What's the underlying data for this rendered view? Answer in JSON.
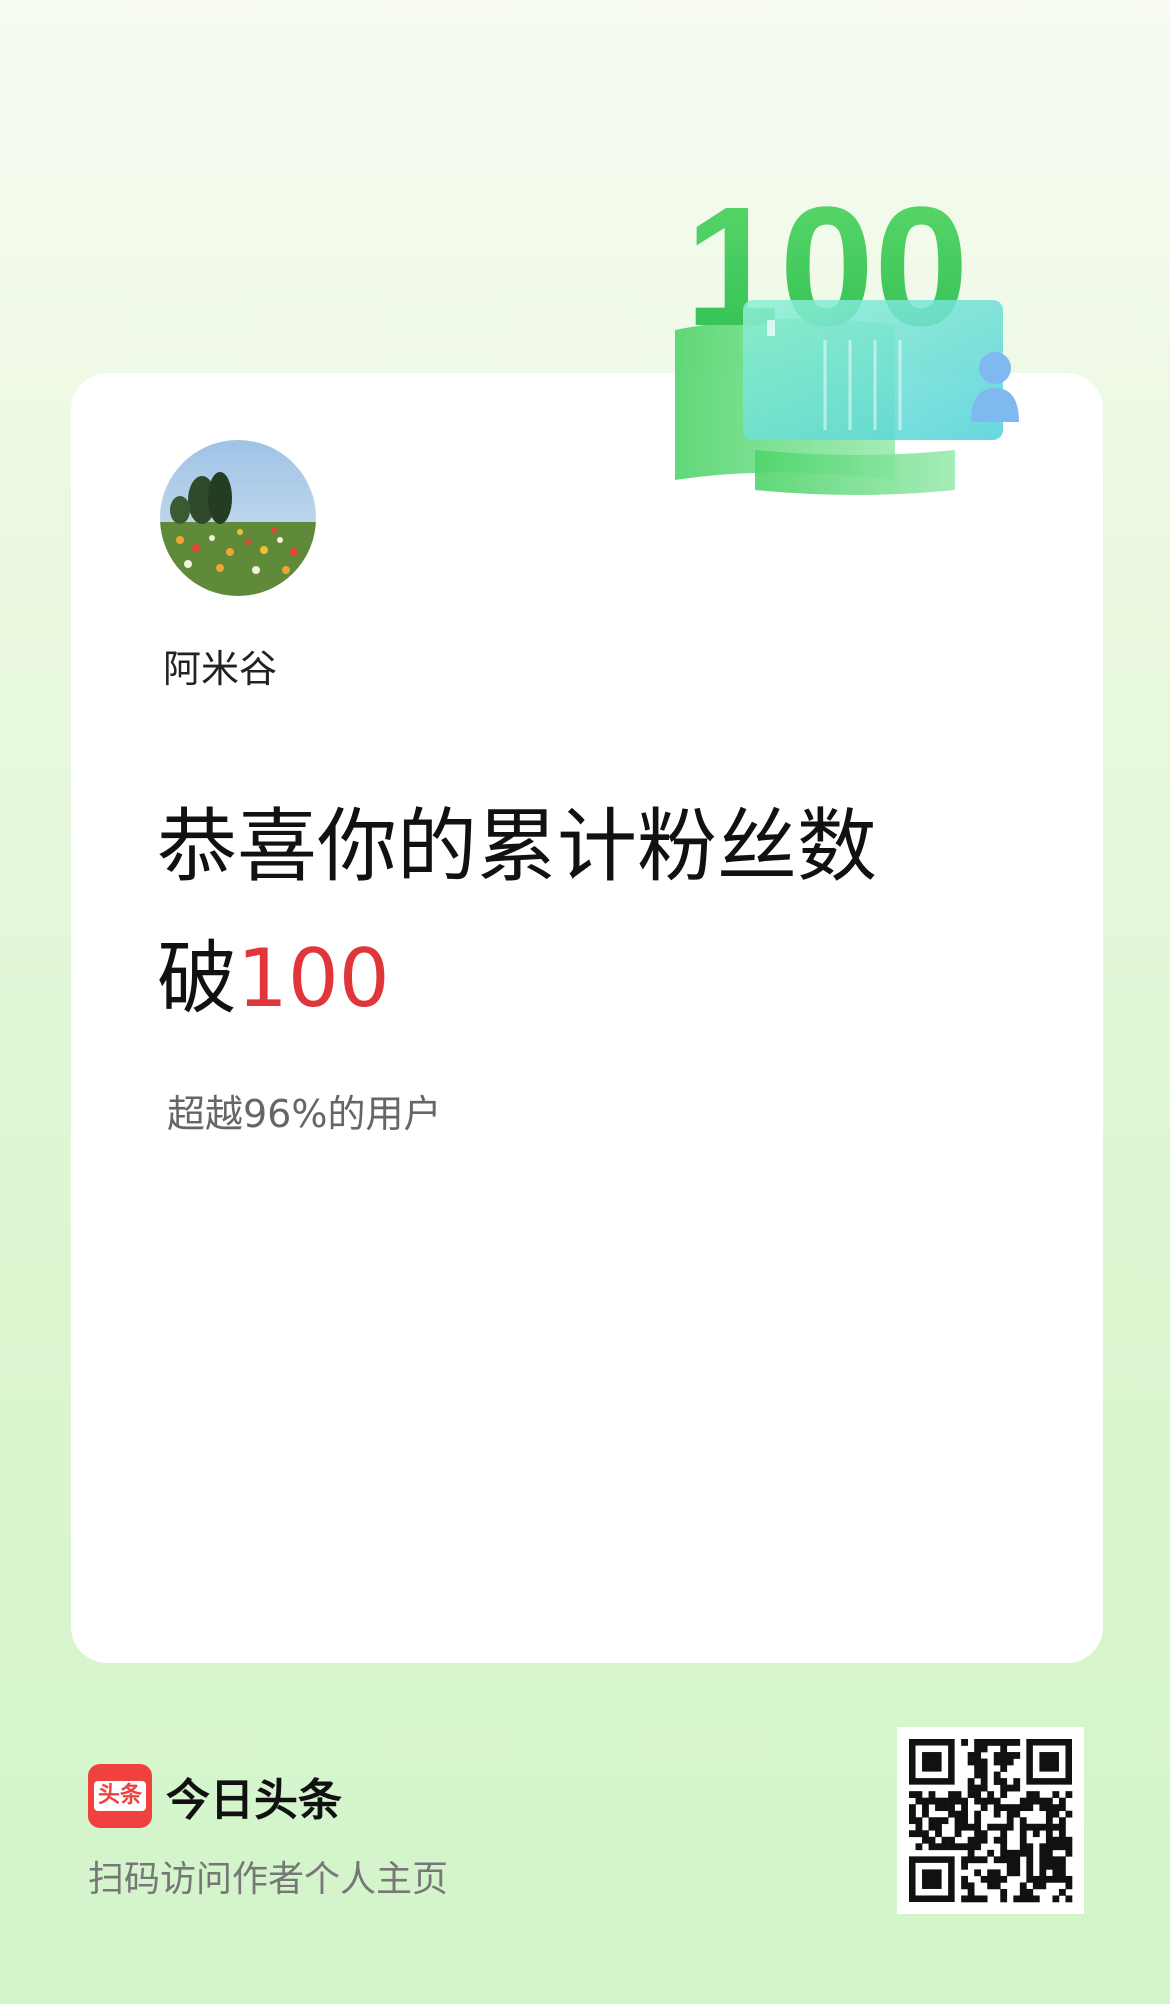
{
  "author": {
    "name": "阿米谷"
  },
  "headline": {
    "line1": "恭喜你的累计粉丝数",
    "prefix": "破",
    "number": "100"
  },
  "rank": {
    "text": "超越96%的用户"
  },
  "badge": {
    "number": "100"
  },
  "brand": {
    "logo_text": "头条",
    "name": "今日头条",
    "caption": "扫码访问作者个人主页"
  },
  "colors": {
    "accent": "#e0353b",
    "brand_red": "#f0413e",
    "badge_green": "#3fcf5c"
  }
}
